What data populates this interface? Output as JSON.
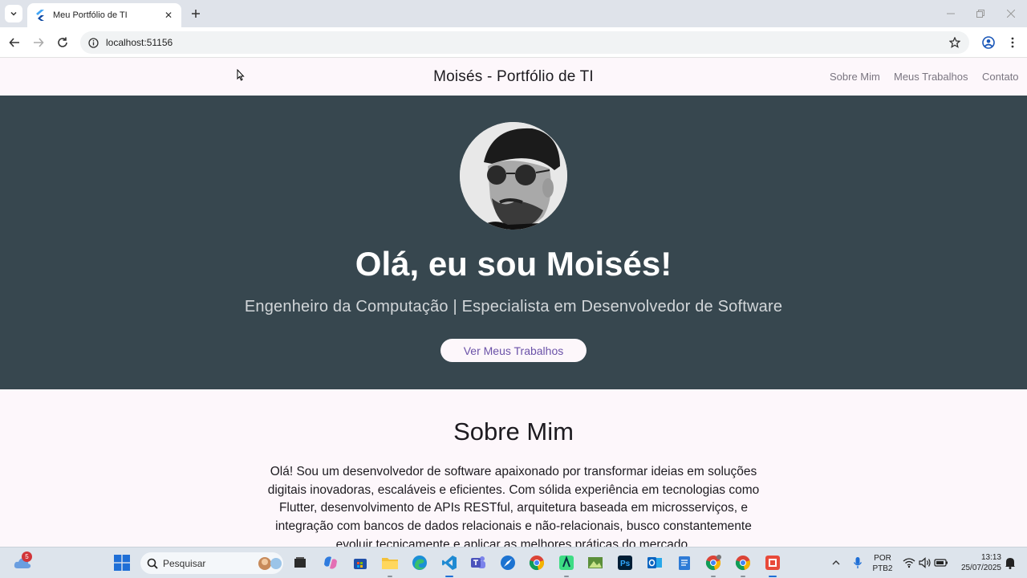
{
  "browser": {
    "tab_title": "Meu Portfólio de TI",
    "url": "localhost:51156"
  },
  "page": {
    "appbar_title": "Moisés - Portfólio de TI",
    "nav": [
      "Sobre Mim",
      "Meus Trabalhos",
      "Contato"
    ],
    "hero": {
      "title": "Olá, eu sou Moisés!",
      "subtitle": "Engenheiro da Computação | Especialista em Desenvolvedor de Software",
      "button": "Ver Meus Trabalhos"
    },
    "about": {
      "title": "Sobre Mim",
      "lines": [
        "Olá! Sou um desenvolvedor de software apaixonado por transformar ideias em soluções",
        "digitais inovadoras, escaláveis e eficientes. Com sólida experiência em tecnologias como",
        "Flutter, desenvolvimento de APIs RESTful, arquitetura baseada em microsserviços, e",
        "integração com bancos de dados relacionais e não-relacionais, busco constantemente",
        "evoluir tecnicamente e aplicar as melhores práticas do mercado."
      ]
    }
  },
  "taskbar": {
    "weather_badge": "5",
    "search_placeholder": "Pesquisar",
    "language": "POR",
    "layout": "PTB2",
    "time": "13:13",
    "date": "25/07/2025"
  },
  "colors": {
    "hero_bg": "#37474f",
    "page_bg": "#fdf7fb",
    "accent": "#6b52a8"
  }
}
